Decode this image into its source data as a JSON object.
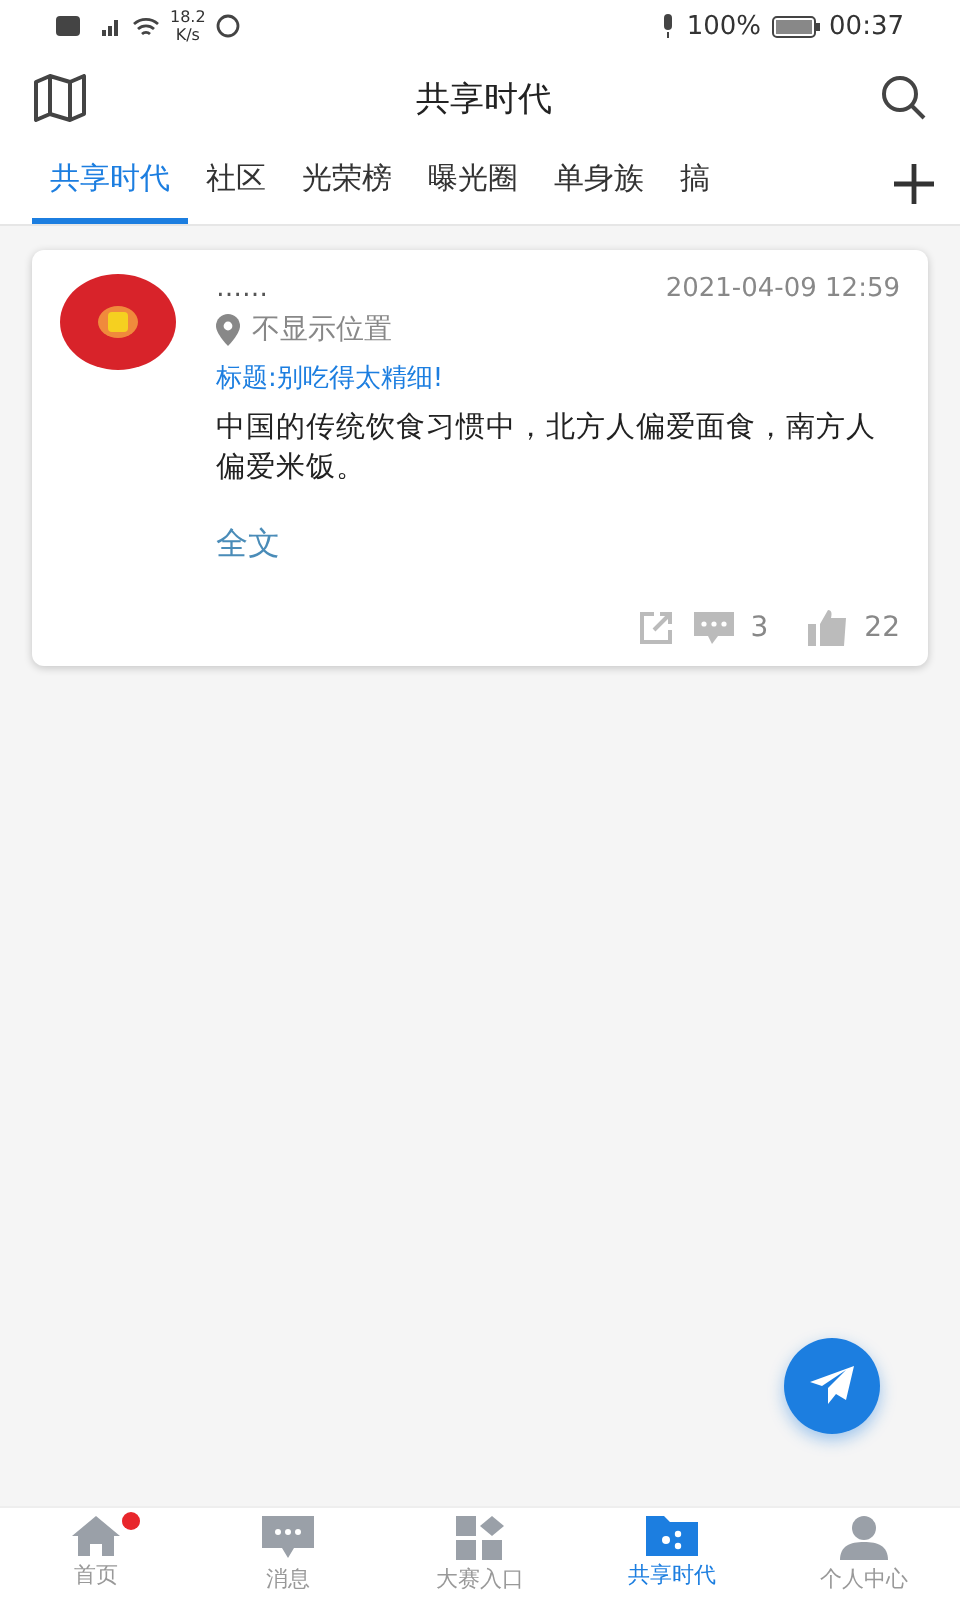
{
  "status_bar": {
    "speed": "18.2",
    "speed_unit": "K/s",
    "battery": "100%",
    "time": "00:37"
  },
  "header": {
    "title": "共享时代"
  },
  "tabs": [
    {
      "label": "共享时代",
      "selected": true
    },
    {
      "label": "社区",
      "selected": false
    },
    {
      "label": "光荣榜",
      "selected": false
    },
    {
      "label": "曝光圈",
      "selected": false
    },
    {
      "label": "单身族",
      "selected": false
    },
    {
      "label": "搞",
      "selected": false
    }
  ],
  "posts": [
    {
      "author": "……",
      "time": "2021-04-09 12:59",
      "location": "不显示位置",
      "title": "标题:别吃得太精细!",
      "body": "中国的传统饮食习惯中，北方人偏爱面食，南方人偏爱米饭。",
      "more": "全文",
      "comments": "3",
      "likes": "22"
    }
  ],
  "bottom_nav": [
    {
      "kind": "home",
      "label": "首页",
      "selected": false,
      "dot": true
    },
    {
      "kind": "message",
      "label": "消息",
      "selected": false,
      "dot": false
    },
    {
      "kind": "grid",
      "label": "大赛入口",
      "selected": false,
      "dot": false
    },
    {
      "kind": "folder",
      "label": "共享时代",
      "selected": true,
      "dot": false
    },
    {
      "kind": "person",
      "label": "个人中心",
      "selected": false,
      "dot": false
    }
  ]
}
